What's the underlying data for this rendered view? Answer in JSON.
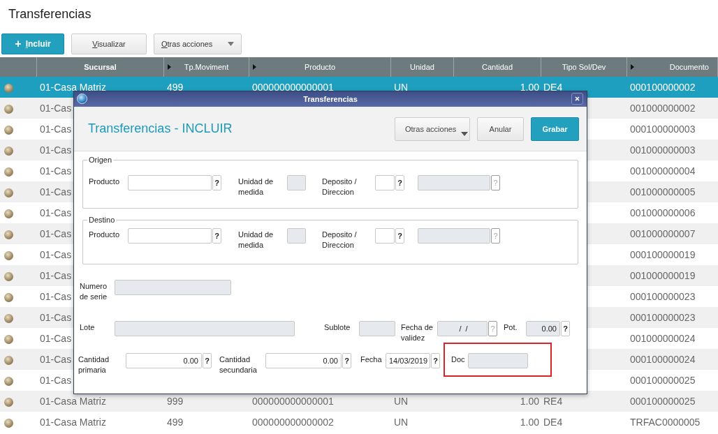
{
  "page_title": "Transferencias",
  "toolbar": [
    {
      "label": "Incluir",
      "kind": "primary",
      "icon": "+"
    },
    {
      "label": "Visualizar",
      "kind": "plain"
    },
    {
      "label": "Otras acciones",
      "kind": "menu"
    }
  ],
  "table": {
    "columns": [
      {
        "label": "Sucursal",
        "marker": false
      },
      {
        "label": "Tp.Moviment",
        "marker": true
      },
      {
        "label": "Producto",
        "marker": true
      },
      {
        "label": "Unidad",
        "marker": false
      },
      {
        "label": "Cantidad",
        "marker": false
      },
      {
        "label": "Tipo Sol/Dev",
        "marker": false
      },
      {
        "label": "Documento",
        "marker": true
      }
    ],
    "rows": [
      {
        "selected": true,
        "sucursal": "01-Casa Matriz",
        "tp": "499",
        "producto": "000000000000001",
        "unidad": "UN",
        "cantidad": "1.00",
        "tipo": "DE4",
        "documento": "000100000002"
      },
      {
        "selected": false,
        "sucursal": "01-Cas",
        "documento": "001000000002"
      },
      {
        "selected": false,
        "sucursal": "01-Cas",
        "documento": "000100000003"
      },
      {
        "selected": false,
        "sucursal": "01-Cas",
        "documento": "001000000003"
      },
      {
        "selected": false,
        "sucursal": "01-Cas",
        "documento": "001000000004"
      },
      {
        "selected": false,
        "sucursal": "01-Cas",
        "documento": "001000000005"
      },
      {
        "selected": false,
        "sucursal": "01-Cas",
        "documento": "001000000006"
      },
      {
        "selected": false,
        "sucursal": "01-Cas",
        "documento": "001000000007"
      },
      {
        "selected": false,
        "sucursal": "01-Cas",
        "documento": "000100000019"
      },
      {
        "selected": false,
        "sucursal": "01-Cas",
        "documento": "001000000019"
      },
      {
        "selected": false,
        "sucursal": "01-Cas",
        "documento": "000100000023"
      },
      {
        "selected": false,
        "sucursal": "01-Cas",
        "documento": "000100000023"
      },
      {
        "selected": false,
        "sucursal": "01-Cas",
        "documento": "001000000024"
      },
      {
        "selected": false,
        "sucursal": "01-Cas",
        "documento": "000100000024"
      },
      {
        "selected": false,
        "sucursal": "01-Cas",
        "documento": "000100000025"
      },
      {
        "selected": false,
        "sucursal": "01-Casa Matriz",
        "tp": "999",
        "producto": "000000000000001",
        "unidad": "UN",
        "cantidad": "1.00",
        "tipo": "RE4",
        "documento": "000100000025"
      },
      {
        "selected": false,
        "sucursal": "01-Casa Matriz",
        "tp": "499",
        "producto": "000000000000002",
        "unidad": "UN",
        "cantidad": "1.00",
        "tipo": "DE4",
        "documento": "TRFAC0000005"
      }
    ]
  },
  "dialog": {
    "title": "Transferencias",
    "heading": "Transferencias - INCLUIR",
    "buttons": [
      {
        "label": "Otras acciones",
        "kind": "menu"
      },
      {
        "label": "Anular",
        "kind": "plain"
      },
      {
        "label": "Grabar",
        "kind": "primary"
      }
    ],
    "groups": [
      {
        "legend": "Origen",
        "fields": [
          {
            "label": "Producto",
            "enabled": true,
            "help": "?",
            "help_enabled": true
          },
          {
            "label": "Unidad de medida",
            "enabled": false
          },
          {
            "label": "Deposito  /  Direccion",
            "enabled": true,
            "help": "?",
            "help_enabled": true
          },
          {
            "enabled": false,
            "help": "?",
            "help_enabled": false
          }
        ]
      },
      {
        "legend": "Destino",
        "fields": [
          {
            "label": "Producto",
            "enabled": true,
            "help": "?",
            "help_enabled": true
          },
          {
            "label": "Unidad de medida",
            "enabled": false
          },
          {
            "label": "Deposito  /  Direccion",
            "enabled": true,
            "help": "?",
            "help_enabled": true
          },
          {
            "enabled": false,
            "help": "?",
            "help_enabled": false
          }
        ]
      }
    ],
    "fields": [
      {
        "label": "Numero de serie",
        "enabled": false
      },
      {
        "label": "Lote",
        "enabled": false
      },
      {
        "label": "Sublote",
        "enabled": false
      },
      {
        "label": "Fecha de validez",
        "enabled": false,
        "value": " /  /",
        "help": "?",
        "help_enabled": false
      },
      {
        "label": "Pot.",
        "enabled": false,
        "value": "0.00",
        "help": "?",
        "help_enabled": true
      },
      {
        "label": "Cantidad primaria",
        "enabled": true,
        "value": "0.00",
        "help": "?",
        "help_enabled": true
      },
      {
        "label": "Cantidad secundaria",
        "enabled": true,
        "value": "0.00",
        "help": "?",
        "help_enabled": true
      },
      {
        "label": "Fecha",
        "enabled": true,
        "value": "14/03/2019",
        "help": "?",
        "help_enabled": true
      },
      {
        "label": "Doc",
        "enabled": false,
        "highlighted": true
      }
    ]
  }
}
